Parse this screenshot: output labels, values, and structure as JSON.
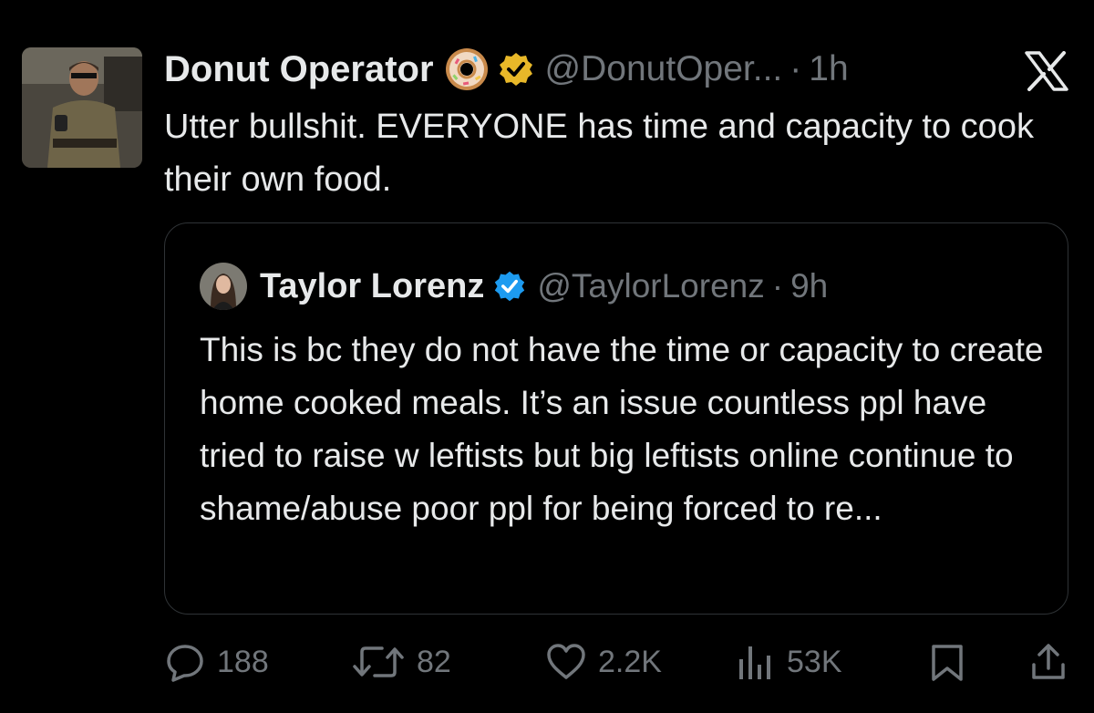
{
  "tweet": {
    "author_name": "Donut Operator",
    "author_emoji": "donut-emoji",
    "author_handle": "@DonutOper...",
    "separator": "·",
    "time": "1h",
    "text": "Utter bullshit. EVERYONE has time and capacity to cook their own food.",
    "platform_logo": "x-logo"
  },
  "quoted": {
    "author_name": "Taylor Lorenz",
    "author_handle": "@TaylorLorenz",
    "separator": "·",
    "time": "9h",
    "text": "This is bc they do not have the time or capacity to create home cooked meals. It’s an issue countless ppl have tried to raise w leftists but big leftists online continue to shame/abuse poor ppl for being forced to re..."
  },
  "actions": {
    "replies": "188",
    "reposts": "82",
    "likes": "2.2K",
    "views": "53K"
  },
  "colors": {
    "background": "#000000",
    "text": "#e7e9ea",
    "muted": "#71767b",
    "verified_gold": "#e8b829",
    "verified_blue": "#1d9bf0"
  }
}
